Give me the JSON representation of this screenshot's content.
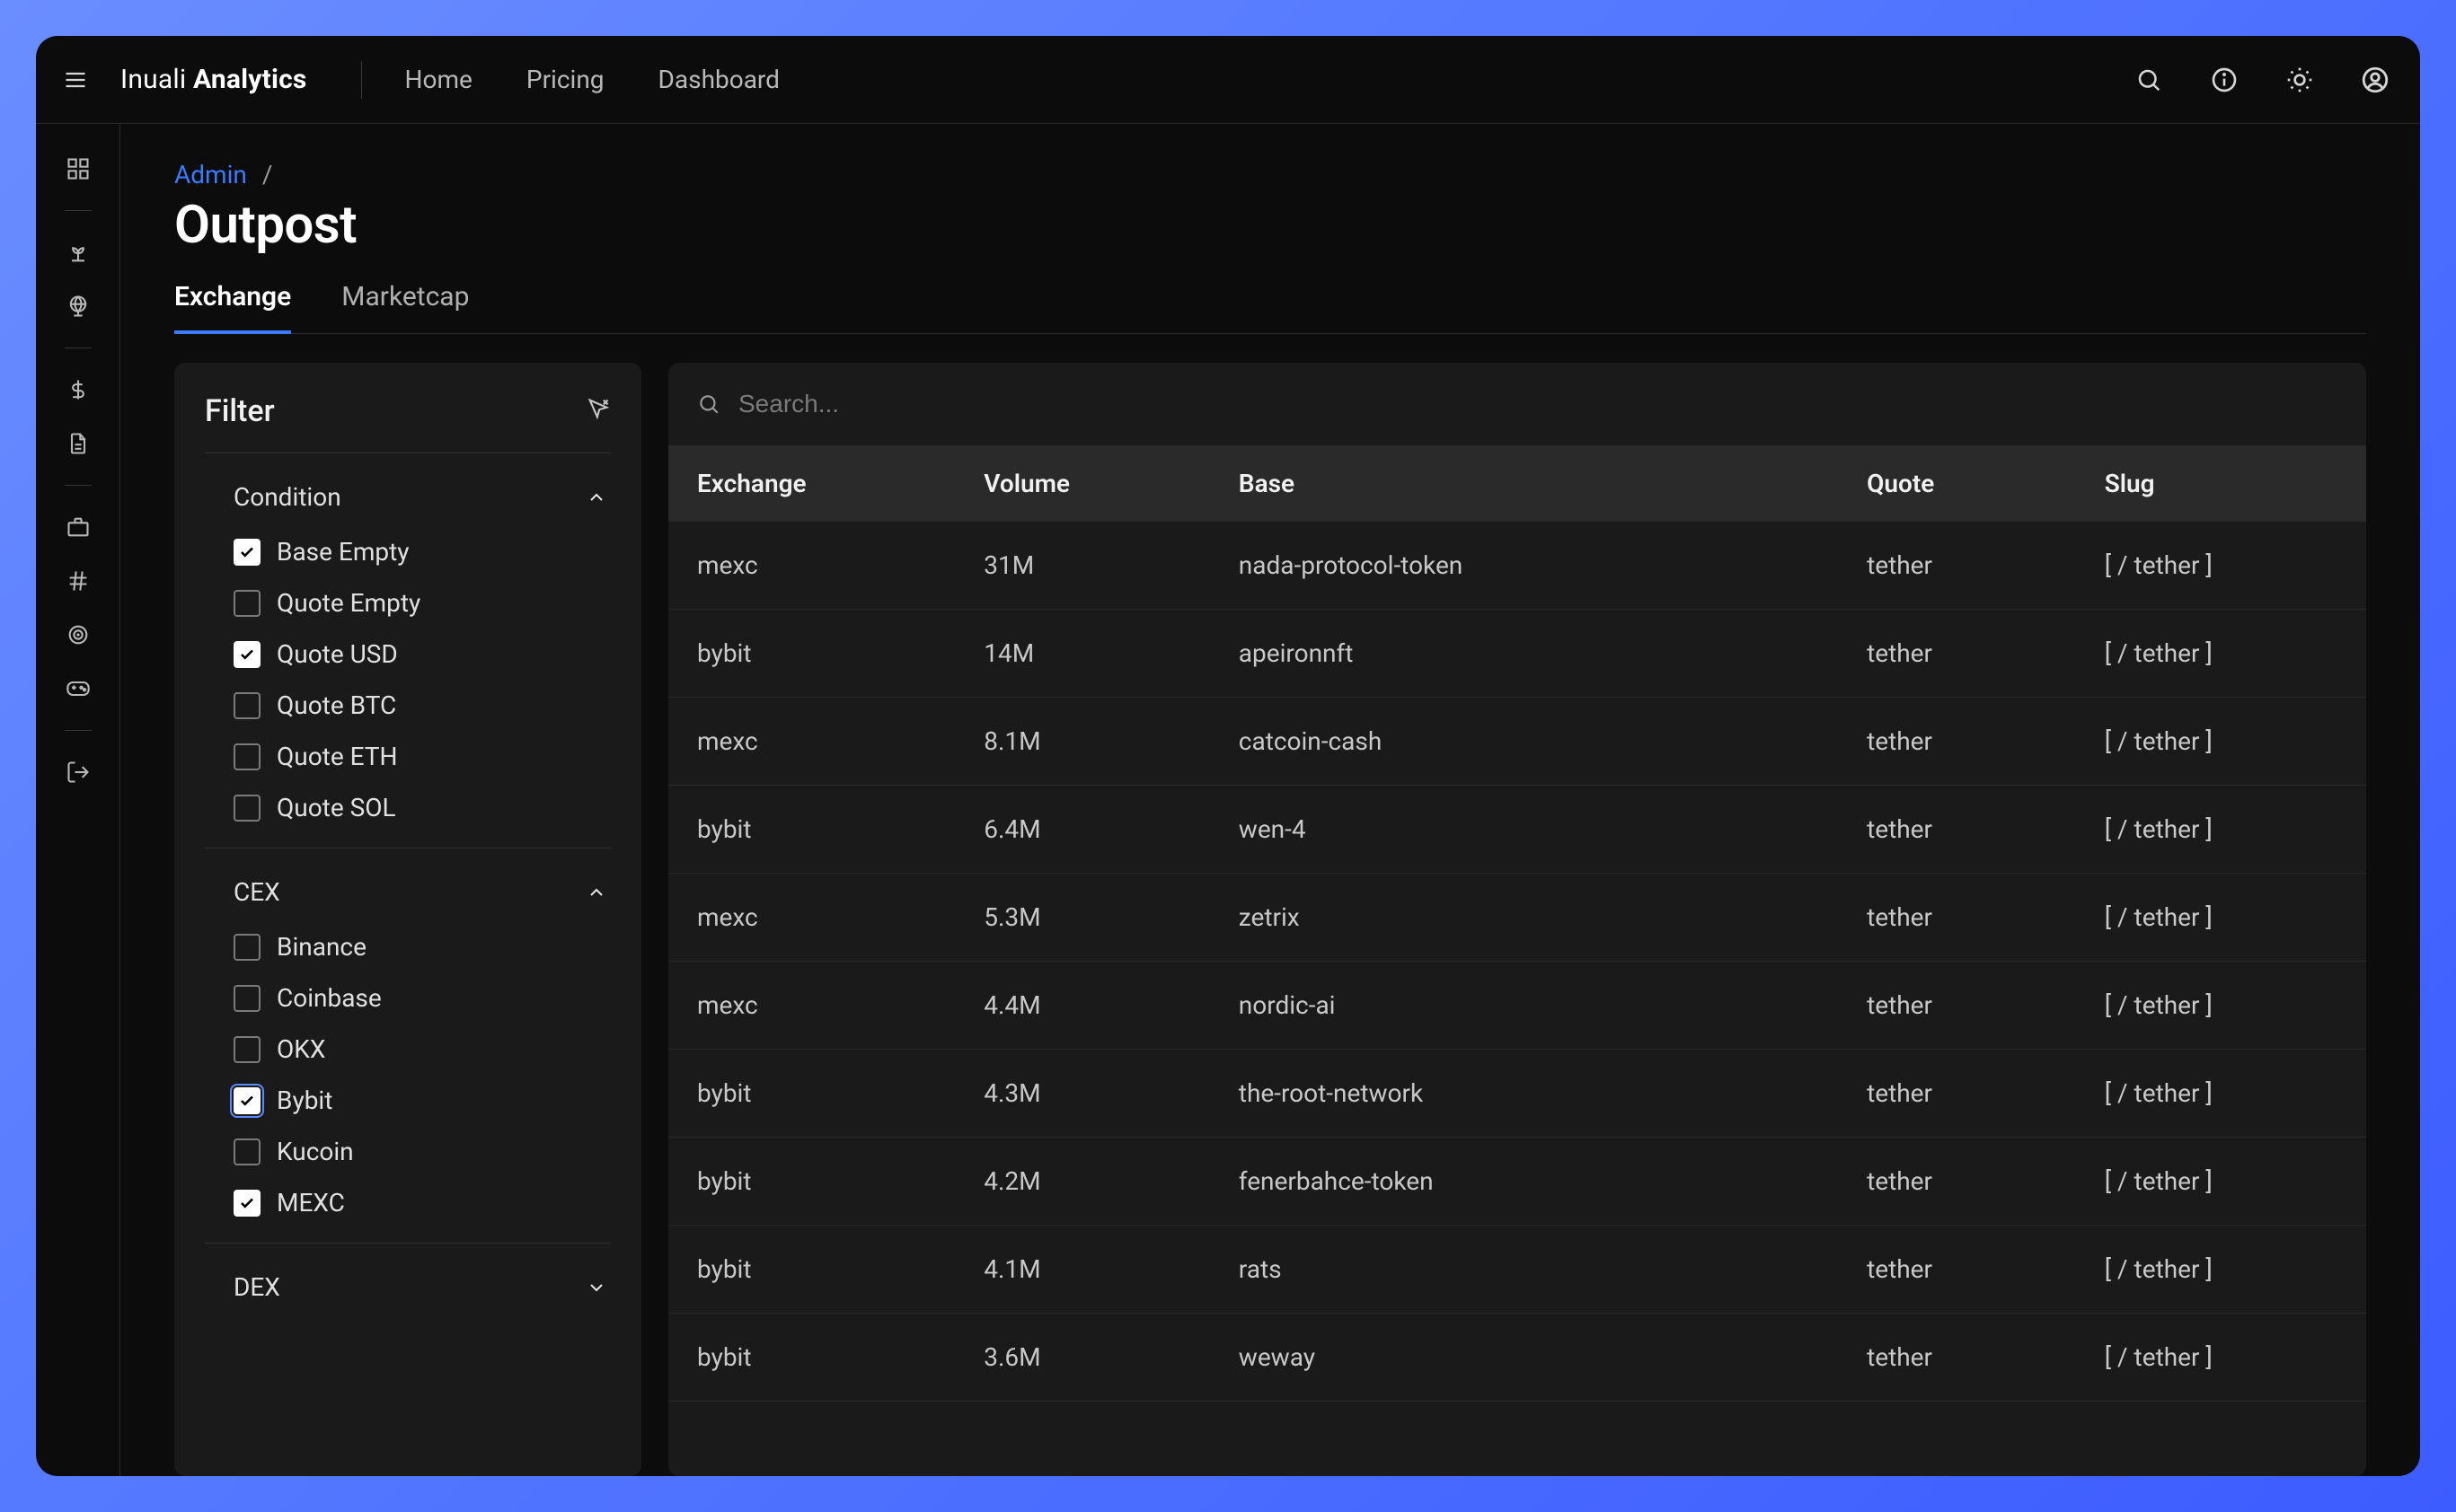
{
  "brand": {
    "light": "Inuali ",
    "bold": "Analytics"
  },
  "topnav": [
    {
      "label": "Home"
    },
    {
      "label": "Pricing"
    },
    {
      "label": "Dashboard"
    }
  ],
  "breadcrumb": {
    "parent": "Admin",
    "sep": "/"
  },
  "page_title": "Outpost",
  "tabs": [
    {
      "label": "Exchange",
      "active": true
    },
    {
      "label": "Marketcap",
      "active": false
    }
  ],
  "filter": {
    "title": "Filter",
    "sections": {
      "condition": {
        "title": "Condition",
        "expanded": true,
        "items": [
          {
            "label": "Base Empty",
            "checked": true
          },
          {
            "label": "Quote Empty",
            "checked": false
          },
          {
            "label": "Quote USD",
            "checked": true
          },
          {
            "label": "Quote BTC",
            "checked": false
          },
          {
            "label": "Quote ETH",
            "checked": false
          },
          {
            "label": "Quote SOL",
            "checked": false
          }
        ]
      },
      "cex": {
        "title": "CEX",
        "expanded": true,
        "items": [
          {
            "label": "Binance",
            "checked": false
          },
          {
            "label": "Coinbase",
            "checked": false
          },
          {
            "label": "OKX",
            "checked": false
          },
          {
            "label": "Bybit",
            "checked": true,
            "focus": true
          },
          {
            "label": "Kucoin",
            "checked": false
          },
          {
            "label": "MEXC",
            "checked": true
          }
        ]
      },
      "dex": {
        "title": "DEX",
        "expanded": false
      }
    }
  },
  "search_placeholder": "Search...",
  "table": {
    "headers": {
      "exchange": "Exchange",
      "volume": "Volume",
      "base": "Base",
      "quote": "Quote",
      "slug": "Slug"
    },
    "rows": [
      {
        "exchange": "mexc",
        "volume": "31M",
        "base": "nada-protocol-token",
        "quote": "tether",
        "slug": "[ / tether ]"
      },
      {
        "exchange": "bybit",
        "volume": "14M",
        "base": "apeironnft",
        "quote": "tether",
        "slug": "[ / tether ]"
      },
      {
        "exchange": "mexc",
        "volume": "8.1M",
        "base": "catcoin-cash",
        "quote": "tether",
        "slug": "[ / tether ]"
      },
      {
        "exchange": "bybit",
        "volume": "6.4M",
        "base": "wen-4",
        "quote": "tether",
        "slug": "[ / tether ]"
      },
      {
        "exchange": "mexc",
        "volume": "5.3M",
        "base": "zetrix",
        "quote": "tether",
        "slug": "[ / tether ]"
      },
      {
        "exchange": "mexc",
        "volume": "4.4M",
        "base": "nordic-ai",
        "quote": "tether",
        "slug": "[ / tether ]"
      },
      {
        "exchange": "bybit",
        "volume": "4.3M",
        "base": "the-root-network",
        "quote": "tether",
        "slug": "[ / tether ]"
      },
      {
        "exchange": "bybit",
        "volume": "4.2M",
        "base": "fenerbahce-token",
        "quote": "tether",
        "slug": "[ / tether ]"
      },
      {
        "exchange": "bybit",
        "volume": "4.1M",
        "base": "rats",
        "quote": "tether",
        "slug": "[ / tether ]"
      },
      {
        "exchange": "bybit",
        "volume": "3.6M",
        "base": "weway",
        "quote": "tether",
        "slug": "[ / tether ]"
      }
    ]
  }
}
